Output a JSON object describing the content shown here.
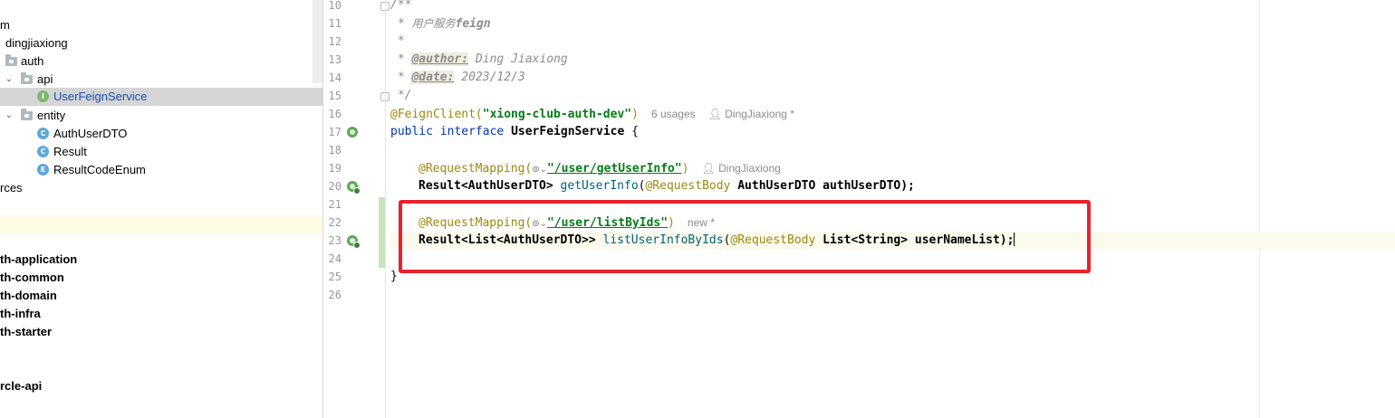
{
  "tree": {
    "rows": [
      {
        "label": "m",
        "bold": false
      },
      {
        "label": "dingjiaxiong",
        "bold": false
      },
      {
        "label": "auth",
        "bold": false
      },
      {
        "label": "api",
        "bold": false
      },
      {
        "label": "UserFeignService",
        "bold": false
      },
      {
        "label": "entity",
        "bold": false
      },
      {
        "label": "AuthUserDTO",
        "bold": false
      },
      {
        "label": "Result",
        "bold": false
      },
      {
        "label": "ResultCodeEnum",
        "bold": false
      },
      {
        "label": "rces",
        "bold": false
      },
      {
        "label": "th-application",
        "bold": true
      },
      {
        "label": "th-common",
        "bold": true
      },
      {
        "label": "th-domain",
        "bold": true
      },
      {
        "label": "th-infra",
        "bold": true
      },
      {
        "label": "th-starter",
        "bold": true
      },
      {
        "label": "rcle-api",
        "bold": true
      }
    ],
    "icon_letters": {
      "interface": "I",
      "class": "C",
      "enum": "E"
    }
  },
  "gutter": {
    "line_numbers": [
      "10",
      "11",
      "12",
      "13",
      "14",
      "15",
      "16",
      "17",
      "18",
      "19",
      "20",
      "21",
      "22",
      "23",
      "24",
      "25",
      "26"
    ]
  },
  "code": {
    "l10": "/**",
    "l11_star": " * ",
    "l11_cn": "用户服务",
    "l11_word": "feign",
    "l12": " *",
    "l13_star": " * ",
    "l13_tag": "@author:",
    "l13_val": " Ding Jiaxiong",
    "l14_star": " * ",
    "l14_tag": "@date:",
    "l14_val": " 2023/12/3",
    "l15": " */",
    "l16_anno": "@FeignClient(",
    "l16_str": "\"xiong-club-auth-dev\"",
    "l16_close": ")",
    "l16_usages": "6 usages",
    "l16_author": "DingJiaxiong *",
    "l17_kw1": "public",
    "l17_kw2": "interface",
    "l17_name": "UserFeignService",
    "l17_brace": " {",
    "l19_anno": "@RequestMapping(",
    "l19_str": "\"/user/getUserInfo\"",
    "l19_close": ")",
    "l19_author": "DingJiaxiong",
    "l20_type": "Result<AuthUserDTO>",
    "l20_method": "getUserInfo",
    "l20_open": "(",
    "l20_anno": "@RequestBody",
    "l20_param": " AuthUserDTO authUserDTO);",
    "l22_anno": "@RequestMapping(",
    "l22_str": "\"/user/listByIds\"",
    "l22_close": ")",
    "l22_new": "new *",
    "l23_type": "Result<List<AuthUserDTO>>",
    "l23_method": "listUserInfoByIds",
    "l23_open": "(",
    "l23_anno": "@RequestBody",
    "l23_param": " List<String> userNameList);",
    "l25": "}",
    "glob_icon": "⊚⌄"
  },
  "colors": {
    "highlight_box": "#e8222e",
    "keyword": "#0033b3",
    "string": "#067d17",
    "annotation": "#9e880d",
    "method": "#00627a",
    "comment": "#8c8c8c",
    "selected_row": "#d5d5d5"
  }
}
